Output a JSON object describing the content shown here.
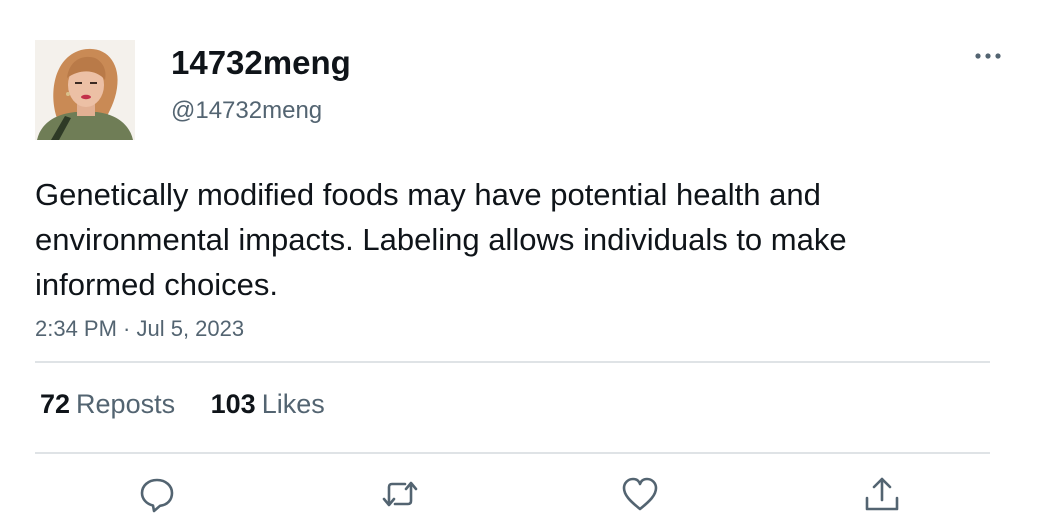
{
  "user": {
    "display_name": "14732meng",
    "handle": "@14732meng",
    "avatar_icon": "profile-photo"
  },
  "tweet": {
    "text": "Genetically modified foods may have potential health and environmental impacts. Labeling allows individuals to make informed choices.",
    "timestamp": "2:34 PM · Jul 5, 2023"
  },
  "stats": {
    "reposts_count": "72",
    "reposts_label": "Reposts",
    "likes_count": "103",
    "likes_label": "Likes"
  },
  "actions": {
    "reply_icon": "speech-bubble-icon",
    "repost_icon": "repost-arrows-icon",
    "like_icon": "heart-icon",
    "share_icon": "share-upload-icon",
    "more_icon": "ellipsis-icon"
  },
  "colors": {
    "text_primary": "#0f1419",
    "text_secondary": "#536471",
    "divider": "#dfe3e6"
  }
}
